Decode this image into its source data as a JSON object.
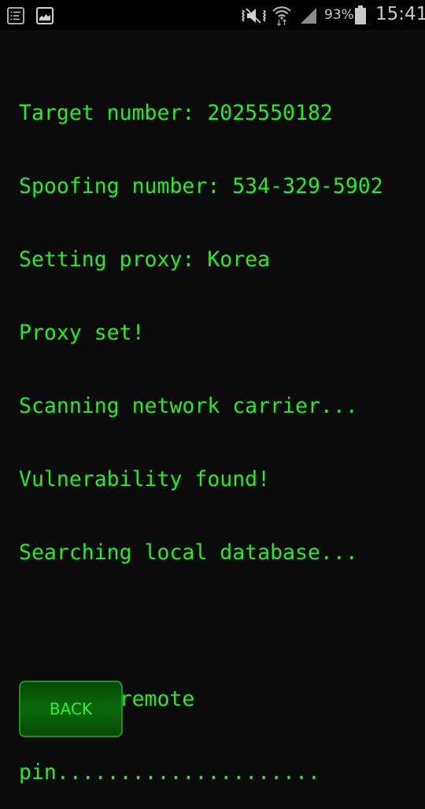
{
  "status_bar": {
    "left_icons": [
      "notification-list-icon",
      "gallery-image-icon"
    ],
    "right_icons": [
      "mute-vibrate-icon",
      "wifi-icon",
      "cellular-signal-icon",
      "battery-icon"
    ],
    "battery_percent": "93%",
    "battery_level": 0.93,
    "time": "15:41"
  },
  "terminal": {
    "lines": [
      "Target number: 2025550182",
      "Spoofing number: 534-329-5902",
      "Setting proxy: Korea",
      "Proxy set!",
      "Scanning network carrier...",
      "Vulnerability found!",
      "Searching local database...",
      "",
      "Hacking remote",
      "pin....................."
    ],
    "text_color": "#22ee22"
  },
  "actions": {
    "back_label": "BACK"
  },
  "colors": {
    "background": "#0b0b0b",
    "accent_green": "#22ee22",
    "button_border": "#1f8f1f"
  }
}
